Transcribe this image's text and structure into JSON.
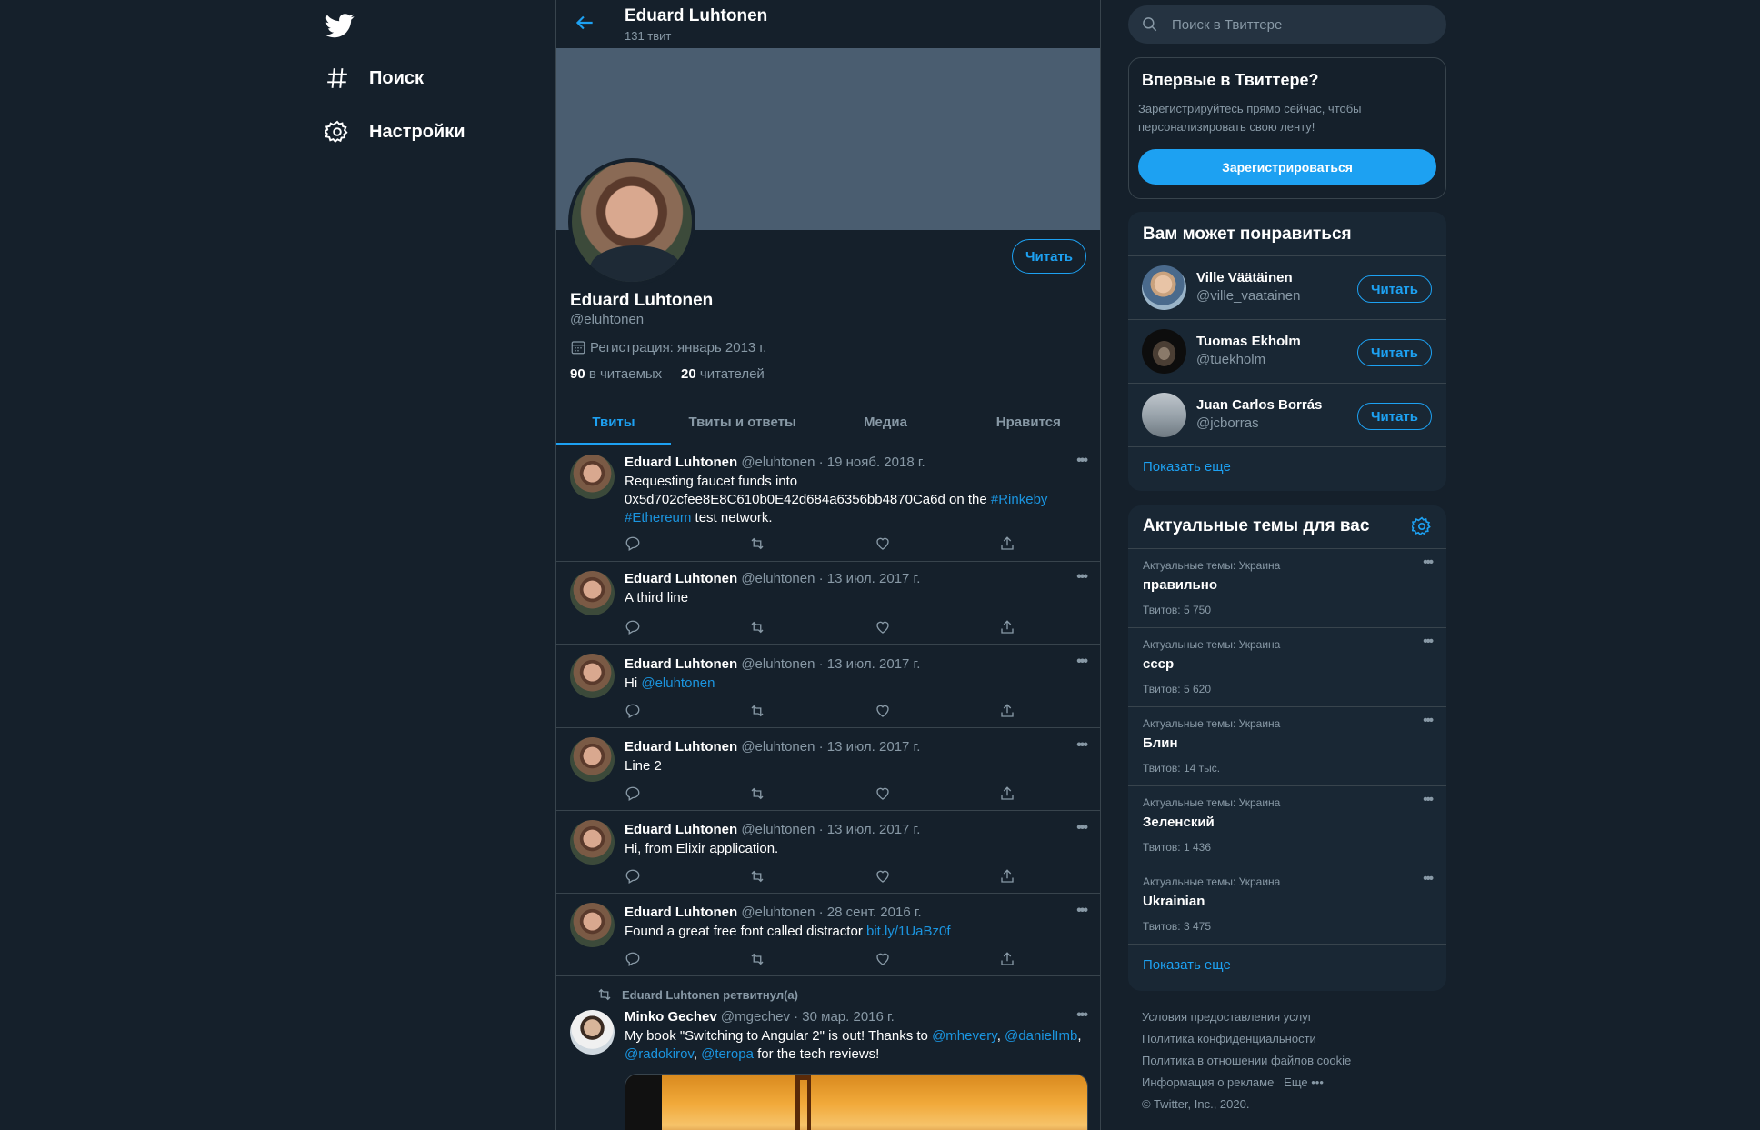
{
  "nav": {
    "search": "Поиск",
    "settings": "Настройки"
  },
  "header": {
    "name": "Eduard Luhtonen",
    "tweet_count": "131 твит"
  },
  "profile": {
    "name": "Eduard Luhtonen",
    "handle": "@eluhtonen",
    "joined": "Регистрация: январь 2013 г.",
    "following_count": "90",
    "following_label": "в читаемых",
    "followers_count": "20",
    "followers_label": "читателей",
    "follow_label": "Читать"
  },
  "tabs": [
    "Твиты",
    "Твиты и ответы",
    "Медиа",
    "Нравится"
  ],
  "tweets": [
    {
      "name": "Eduard Luhtonen",
      "meta": "@eluhtonen · 19 нояб. 2018 г.",
      "text_a": "Requesting faucet funds into 0x5d702cfee8E8C610b0E42d684a6356bb4870Ca6d on the ",
      "link_a": "#Rinkeby",
      "link_b": "#Ethereum",
      "text_b": " test network."
    },
    {
      "name": "Eduard Luhtonen",
      "meta": "@eluhtonen · 13 июл. 2017 г.",
      "text": "A third line"
    },
    {
      "name": "Eduard Luhtonen",
      "meta": "@eluhtonen · 13 июл. 2017 г.",
      "text": "Hi ",
      "link": "@eluhtonen"
    },
    {
      "name": "Eduard Luhtonen",
      "meta": "@eluhtonen · 13 июл. 2017 г.",
      "text": "Line 2"
    },
    {
      "name": "Eduard Luhtonen",
      "meta": "@eluhtonen · 13 июл. 2017 г.",
      "text": "Hi, from Elixir application."
    },
    {
      "name": "Eduard Luhtonen",
      "meta": "@eluhtonen · 28 сент. 2016 г.",
      "text": "Found a great free font called distractor ",
      "link": "bit.ly/1UaBz0f"
    }
  ],
  "retweet": {
    "label": "Eduard Luhtonen ретвитнул(а)",
    "name": "Minko Gechev",
    "meta": "@mgechev · 30 мар. 2016 г.",
    "text_a": "My book \"Switching to Angular 2\" is out! Thanks to ",
    "link_1": "@mhevery",
    "sep_1": ", ",
    "link_2": "@danielImb",
    "sep_2": ",",
    "link_3": "@radokirov",
    "sep_3": ", ",
    "link_4": "@teropa",
    "text_b": " for the tech reviews!"
  },
  "search": {
    "placeholder": "Поиск в Твиттере"
  },
  "new_to_twitter": {
    "title": "Впервые в Твиттере?",
    "desc": "Зарегистрируйтесь прямо сейчас, чтобы персонализировать свою ленту!",
    "button": "Зарегистрироваться"
  },
  "suggestions": {
    "title": "Вам может понравиться",
    "items": [
      {
        "name": "Ville Väätäinen",
        "handle": "@ville_vaatainen",
        "button": "Читать"
      },
      {
        "name": "Tuomas Ekholm",
        "handle": "@tuekholm",
        "button": "Читать"
      },
      {
        "name": "Juan Carlos Borrás",
        "handle": "@jcborras",
        "button": "Читать"
      }
    ],
    "show_more": "Показать еще"
  },
  "trends": {
    "title": "Актуальные темы для вас",
    "items": [
      {
        "context": "Актуальные темы: Украина",
        "topic": "правильно",
        "count": "Твитов: 5 750"
      },
      {
        "context": "Актуальные темы: Украина",
        "topic": "ссср",
        "count": "Твитов: 5 620"
      },
      {
        "context": "Актуальные темы: Украина",
        "topic": "Блин",
        "count": "Твитов: 14 тыс."
      },
      {
        "context": "Актуальные темы: Украина",
        "topic": "Зеленский",
        "count": "Твитов: 1 436"
      },
      {
        "context": "Актуальные темы: Украина",
        "topic": "Ukrainian",
        "count": "Твитов: 3 475"
      }
    ],
    "show_more": "Показать еще"
  },
  "footer": {
    "terms": "Условия предоставления услуг",
    "privacy": "Политика конфиденциальности",
    "cookies": "Политика в отношении файлов cookie",
    "ads": "Информация о рекламе",
    "more": "Еще",
    "copyright": "© Twitter, Inc., 2020."
  },
  "colors": {
    "background": "#15202b",
    "accent": "#1da1f2",
    "muted": "#8899a6",
    "card": "#192734"
  },
  "icons": [
    "twitter-logo-icon",
    "hashtag-icon",
    "gear-icon",
    "back-arrow-icon",
    "calendar-icon",
    "reply-icon",
    "retweet-icon",
    "like-icon",
    "share-icon",
    "search-icon",
    "more-icon"
  ]
}
